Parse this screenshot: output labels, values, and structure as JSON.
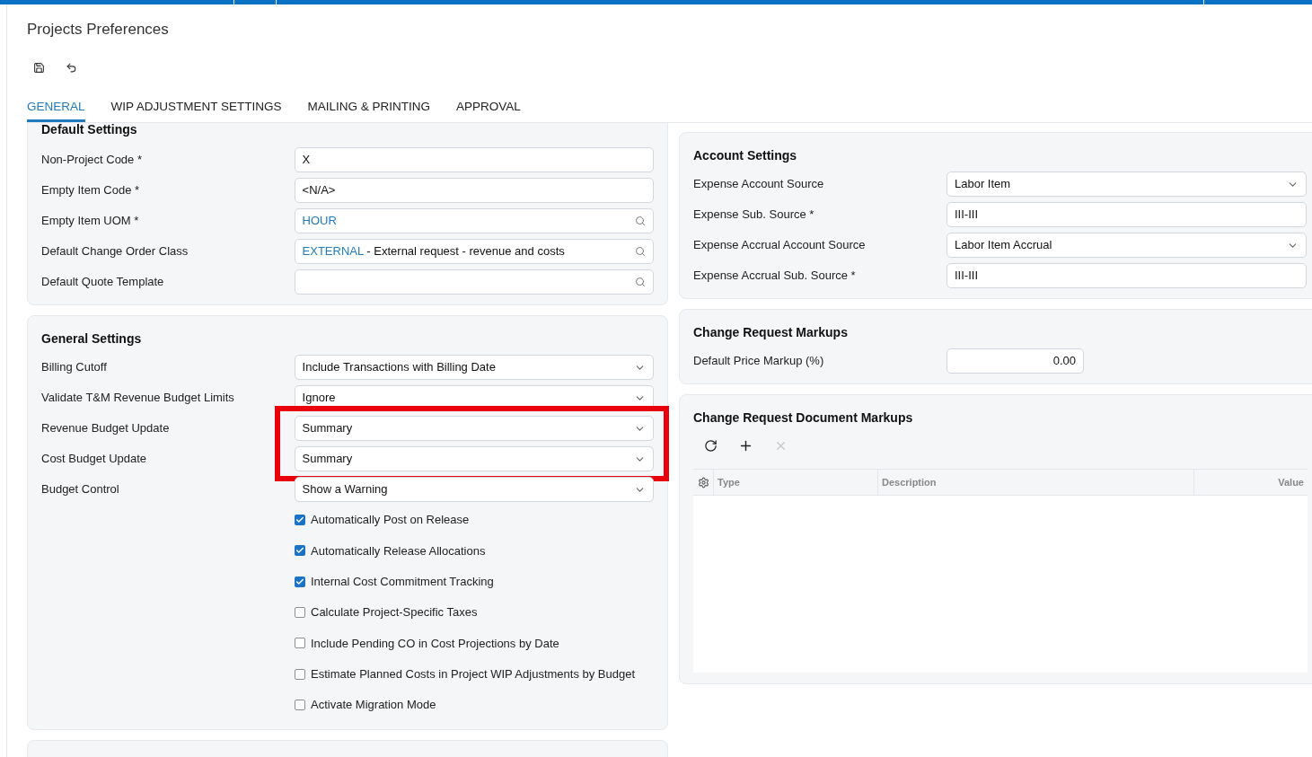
{
  "page_title": "Projects Preferences",
  "tabs": [
    {
      "label": "GENERAL",
      "selected": true
    },
    {
      "label": "WIP ADJUSTMENT SETTINGS",
      "selected": false
    },
    {
      "label": "MAILING & PRINTING",
      "selected": false
    },
    {
      "label": "APPROVAL",
      "selected": false
    }
  ],
  "default_settings": {
    "title": "Default Settings",
    "rows": [
      {
        "kind": "text",
        "label": "Non-Project Code *",
        "value": "X"
      },
      {
        "kind": "text",
        "label": "Empty Item Code *",
        "value": "<N/A>"
      },
      {
        "kind": "lookup",
        "label": "Empty Item UOM *",
        "code": "HOUR"
      },
      {
        "kind": "lookup",
        "label": "Default Change Order Class",
        "code": "EXTERNAL",
        "description": " - External request - revenue and costs"
      },
      {
        "kind": "lookup",
        "label": "Default Quote Template"
      }
    ]
  },
  "general_settings": {
    "title": "General Settings",
    "rows": [
      {
        "kind": "select",
        "label": "Billing Cutoff",
        "value": "Include Transactions with Billing Date",
        "highlighted": false
      },
      {
        "kind": "select",
        "label": "Validate T&M Revenue Budget Limits",
        "value": "Ignore",
        "highlighted": false
      },
      {
        "kind": "select",
        "label": "Revenue Budget Update",
        "value": "Summary",
        "highlighted": true
      },
      {
        "kind": "select",
        "label": "Cost Budget Update",
        "value": "Summary",
        "highlighted": true
      },
      {
        "kind": "select",
        "label": "Budget Control",
        "value": "Show a Warning",
        "highlighted": false
      }
    ],
    "checkboxes": [
      {
        "label": "Automatically Post on Release",
        "checked": true
      },
      {
        "label": "Automatically Release Allocations",
        "checked": true
      },
      {
        "label": "Internal Cost Commitment Tracking",
        "checked": true
      },
      {
        "label": "Calculate Project-Specific Taxes",
        "checked": false
      },
      {
        "label": "Include Pending CO in Cost Projections by Date",
        "checked": false
      },
      {
        "label": "Estimate Planned Costs in Project WIP Adjustments by Budget",
        "checked": false
      },
      {
        "label": "Activate Migration Mode",
        "checked": false
      }
    ]
  },
  "account_settings": {
    "title": "Account Settings",
    "rows": [
      {
        "kind": "select",
        "label": "Expense Account Source",
        "value": "Labor Item"
      },
      {
        "kind": "text",
        "label": "Expense Sub. Source *",
        "value": "III-III"
      },
      {
        "kind": "select",
        "label": "Expense Accrual Account Source",
        "value": "Labor Item Accrual"
      },
      {
        "kind": "text",
        "label": "Expense Accrual Sub. Source *",
        "value": "III-III"
      }
    ]
  },
  "change_request_markups": {
    "title": "Change Request Markups",
    "rows": [
      {
        "kind": "number",
        "label": "Default Price Markup (%)",
        "value": "0.00"
      }
    ]
  },
  "change_request_document_markups": {
    "title": "Change Request Document Markups",
    "toolbar": [
      {
        "kind": "refresh",
        "disabled": false
      },
      {
        "kind": "add",
        "disabled": false
      },
      {
        "kind": "delete",
        "disabled": true
      }
    ],
    "columns": [
      "Type",
      "Description",
      "Value"
    ]
  }
}
